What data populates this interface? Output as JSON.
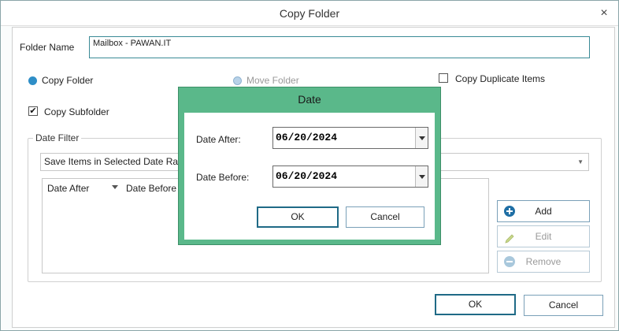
{
  "window": {
    "title": "Copy Folder",
    "close_glyph": "×"
  },
  "form": {
    "folder_name_label": "Folder Name",
    "folder_name_value": "Mailbox - PAWAN.IT",
    "copy_folder_label": "Copy Folder",
    "copy_folder_selected": true,
    "move_folder_label": "Move Folder",
    "copy_duplicate_label": "Copy Duplicate Items",
    "copy_duplicate_checked": false,
    "copy_subfolder_label": "Copy Subfolder",
    "copy_subfolder_checked": true
  },
  "date_filter": {
    "group_label": "Date Filter",
    "dropdown_value": "Save Items in Selected Date Range",
    "columns": [
      "Date After",
      "Date Before"
    ],
    "buttons": {
      "add": "Add",
      "edit": "Edit",
      "remove": "Remove"
    }
  },
  "footer": {
    "ok": "OK",
    "cancel": "Cancel"
  },
  "date_dialog": {
    "title": "Date",
    "date_after_label": "Date After:",
    "date_after_value": "06/20/2024",
    "date_before_label": "Date Before:",
    "date_before_value": "06/20/2024",
    "ok": "OK",
    "cancel": "Cancel"
  },
  "colors": {
    "accent": "#2e8ec7",
    "dialog_frame": "#5ab88a",
    "primary_border": "#1f6a86"
  },
  "icons": {
    "add": "plus-circle-icon",
    "edit": "pencil-icon",
    "remove": "minus-circle-icon",
    "close": "close-icon"
  }
}
